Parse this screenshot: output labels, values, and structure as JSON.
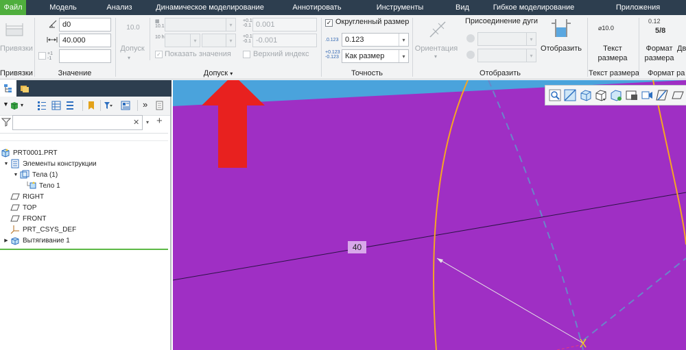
{
  "menu": {
    "items": [
      {
        "label": "Файл",
        "active": true
      },
      {
        "label": "Модель"
      },
      {
        "label": "Анализ"
      },
      {
        "label": "Динамическое моделирование"
      },
      {
        "label": "Аннотировать"
      },
      {
        "label": "Инструменты"
      },
      {
        "label": "Вид"
      },
      {
        "label": "Гибкое моделирование"
      },
      {
        "label": "Приложения"
      }
    ]
  },
  "ribbon": {
    "snaps": {
      "button_label": "Привязки",
      "group_label": "Привязки"
    },
    "value": {
      "name_value": "d0",
      "dim_value": "40.000",
      "extra_value": "",
      "group_label": "Значение"
    },
    "tolerance": {
      "button_value": "10.0",
      "button_label": "Допуск",
      "show_values_label": "Показать значения",
      "upper_value": "0.001",
      "lower_value": "-0.001",
      "upper_index_label": "Верхний индекс",
      "group_label": "Допуск"
    },
    "precision": {
      "rounded_label": "Округленный размер",
      "rounded_checked": true,
      "decimals_value": "0.123",
      "tolerance_format_value": "Как размер",
      "group_label": "Точность"
    },
    "display": {
      "orientation_label": "Ориентация",
      "arc_join_label": "Присоединение дуги",
      "show_label": "Отобразить",
      "group_label": "Отобразить"
    },
    "dim_text": {
      "icon_value": "⌀10.0",
      "button_label_1": "Текст",
      "button_label_2": "размера",
      "group_label": "Текст размера"
    },
    "dim_format": {
      "icon_value_1": "0.12",
      "icon_value_2": "5/8",
      "button_label_1": "Формат",
      "button_label_2": "размера",
      "extra_label": "Дв",
      "group_label": "Формат ра"
    }
  },
  "tree": {
    "filter_value": "",
    "items": [
      {
        "label": "PRT0001.PRT",
        "level": 0
      },
      {
        "label": "Элементы конструкции",
        "level": 1
      },
      {
        "label": "Тела (1)",
        "level": 2
      },
      {
        "label": "Тело 1",
        "level": 3
      },
      {
        "label": "RIGHT",
        "level": 1
      },
      {
        "label": "TOP",
        "level": 1
      },
      {
        "label": "FRONT",
        "level": 1
      },
      {
        "label": "PRT_CSYS_DEF",
        "level": 1
      },
      {
        "label": "Вытягивание 1",
        "level": 1
      }
    ]
  },
  "viewport": {
    "dimension_label": "40"
  },
  "colors": {
    "menubar": "#2d3e4f",
    "active_tab": "#4fae3d",
    "model_fill": "#9f2fc4",
    "background_blue": "#4aa3dc",
    "arrow": "#e8211f",
    "edge_highlight": "#f6a623"
  }
}
